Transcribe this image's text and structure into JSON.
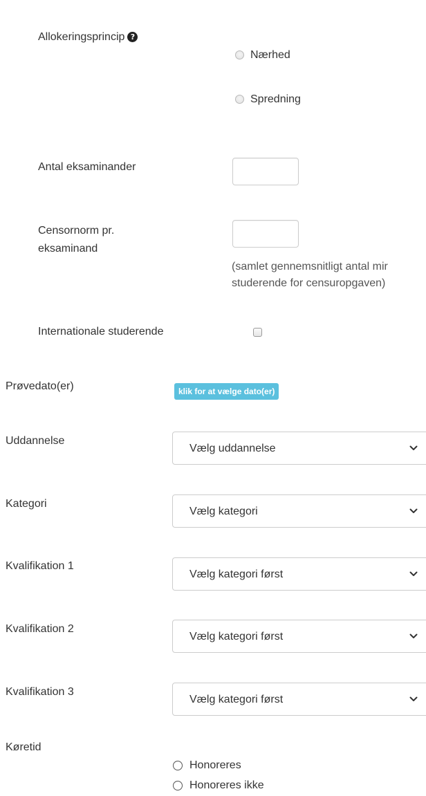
{
  "allocation": {
    "label": "Allokeringsprincip",
    "help_icon": "question-circle-icon",
    "options": [
      "Nærhed",
      "Spredning"
    ]
  },
  "examinees": {
    "label": "Antal eksaminander",
    "value": ""
  },
  "censor_norm": {
    "label_line1": "Censornorm pr.",
    "label_line2": "eksaminand",
    "value": "",
    "help_line1": "(samlet gennemsnitligt antal mir",
    "help_line2": "studerende for censuropgaven)"
  },
  "international": {
    "label": "Internationale studerende",
    "checked": false
  },
  "exam_dates": {
    "label": "Prøvedato(er)",
    "button_label": "klik for at vælge dato(er)",
    "button_color": "#5bc0de"
  },
  "education": {
    "label": "Uddannelse",
    "selected": "Vælg uddannelse"
  },
  "category": {
    "label": "Kategori",
    "selected": "Vælg kategori"
  },
  "qualification1": {
    "label": "Kvalifikation 1",
    "selected": "Vælg kategori først"
  },
  "qualification2": {
    "label": "Kvalifikation 2",
    "selected": "Vælg kategori først"
  },
  "qualification3": {
    "label": "Kvalifikation 3",
    "selected": "Vælg kategori først"
  },
  "travel_time": {
    "label": "Køretid",
    "options": [
      "Honoreres",
      "Honoreres ikke"
    ]
  }
}
